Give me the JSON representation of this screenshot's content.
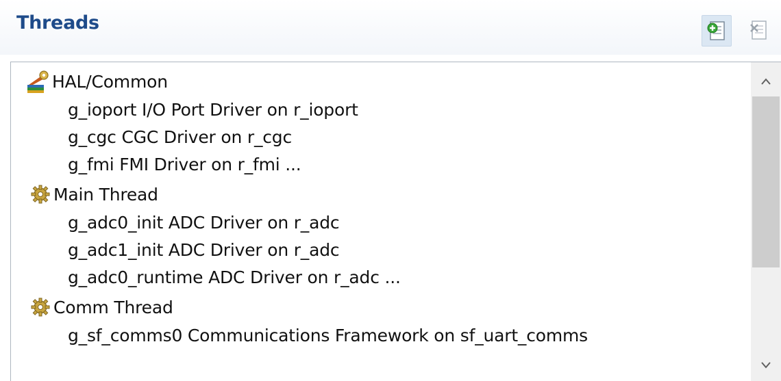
{
  "panel": {
    "title": "Threads",
    "toolbar": {
      "add_icon": "add-thread-icon",
      "remove_icon": "remove-thread-icon"
    }
  },
  "tree": {
    "nodes": [
      {
        "label": "HAL/Common",
        "icon": "hal-common-icon",
        "children": [
          "g_ioport I/O Port Driver on r_ioport",
          "g_cgc CGC Driver on r_cgc",
          "g_fmi FMI Driver on r_fmi ..."
        ]
      },
      {
        "label": "Main Thread",
        "icon": "gear-icon",
        "children": [
          "g_adc0_init ADC Driver on r_adc",
          "g_adc1_init ADC Driver on r_adc",
          "g_adc0_runtime ADC Driver on r_adc ..."
        ]
      },
      {
        "label": "Comm Thread",
        "icon": "gear-icon",
        "children": [
          "g_sf_comms0 Communications Framework on sf_uart_comms"
        ]
      }
    ]
  },
  "scrollbar": {
    "up_glyph": "^",
    "down_glyph": "v"
  },
  "colors": {
    "title": "#1e4b8a",
    "toolbar_active_bg": "#dbe7f3",
    "scroll_thumb": "#cdcdcd"
  }
}
